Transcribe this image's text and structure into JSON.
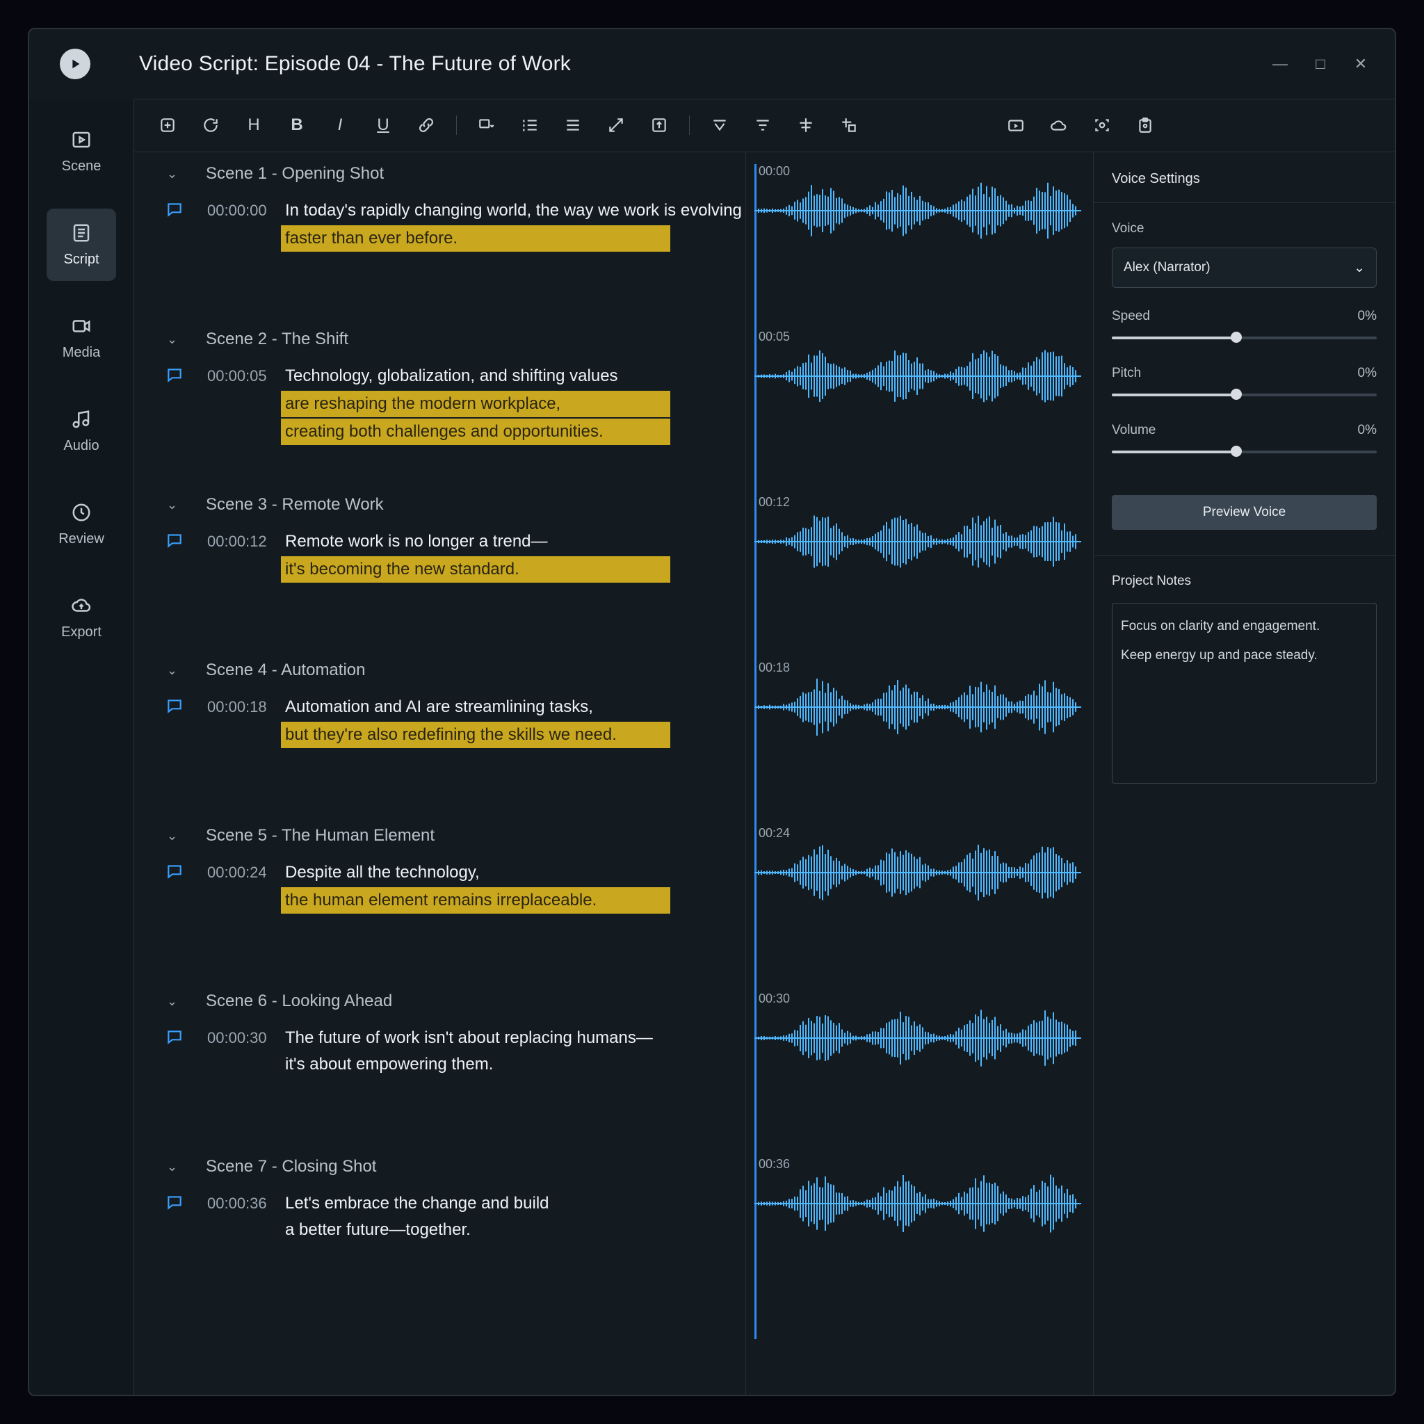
{
  "app": {
    "title": "Video Script: Episode 04 - The Future of Work"
  },
  "sidebar": {
    "items": [
      {
        "label": "Scene",
        "icon": "scene-icon"
      },
      {
        "label": "Script",
        "icon": "script-icon",
        "active": true
      },
      {
        "label": "Media",
        "icon": "media-icon"
      },
      {
        "label": "Audio",
        "icon": "audio-icon"
      },
      {
        "label": "Review",
        "icon": "review-icon"
      },
      {
        "label": "Export",
        "icon": "export-icon"
      }
    ]
  },
  "toolbar": {
    "heading_label": "H",
    "bold_label": "B",
    "italic_label": "I",
    "underline_label": "U"
  },
  "scenes": [
    {
      "title": "Scene 1 - Opening Shot",
      "time": "00:00:00",
      "lines": [
        "In today's rapidly changing world, the way we work is evolving",
        "faster than ever before."
      ],
      "highlight": [
        false,
        true
      ]
    },
    {
      "title": "Scene 2 - The Shift",
      "time": "00:00:05",
      "lines": [
        "Technology, globalization, and shifting values",
        "are reshaping the modern workplace,",
        "creating both challenges and opportunities."
      ],
      "highlight": [
        false,
        true,
        true
      ]
    },
    {
      "title": "Scene 3 - Remote Work",
      "time": "00:00:12",
      "lines": [
        "Remote work is no longer a trend—",
        "it's becoming the new standard."
      ],
      "highlight": [
        false,
        true
      ]
    },
    {
      "title": "Scene 4 - Automation",
      "time": "00:00:18",
      "lines": [
        "Automation and AI are streamlining tasks,",
        "but they're also redefining the skills we need."
      ],
      "highlight": [
        false,
        true
      ]
    },
    {
      "title": "Scene 5 - The Human Element",
      "time": "00:00:24",
      "lines": [
        "Despite all the technology,",
        "the human element remains irreplaceable."
      ],
      "highlight": [
        false,
        true
      ]
    },
    {
      "title": "Scene 6 - Looking Ahead",
      "time": "00:00:30",
      "lines": [
        "The future of work isn't about replacing humans—",
        "it's about empowering them."
      ],
      "highlight": [
        false,
        false
      ]
    },
    {
      "title": "Scene 7 - Closing Shot",
      "time": "00:00:36",
      "lines": [
        "Let's embrace the change and build",
        "a better future—together."
      ],
      "highlight": [
        false,
        false
      ]
    }
  ],
  "timeline": {
    "markers": [
      "00:00",
      "00:05",
      "00:12",
      "00:18",
      "00:24",
      "00:30",
      "00:36"
    ]
  },
  "voice_settings": {
    "title": "Voice Settings",
    "voice_label": "Voice",
    "voice_value": "Alex (Narrator)",
    "speed_label": "Speed",
    "speed_value": "0%",
    "speed_level": 0.47,
    "pitch_label": "Pitch",
    "pitch_value": "0%",
    "pitch_level": 0.47,
    "volume_label": "Volume",
    "volume_value": "0%",
    "volume_level": 0.47,
    "preview_label": "Preview Voice"
  },
  "project_notes": {
    "title": "Project Notes",
    "notes": [
      "Focus on clarity and engagement.",
      "Keep energy up and pace steady."
    ]
  },
  "colors": {
    "accent": "#2e8cf0",
    "highlight": "#c9a820",
    "waveform": "#4fb8ff"
  }
}
